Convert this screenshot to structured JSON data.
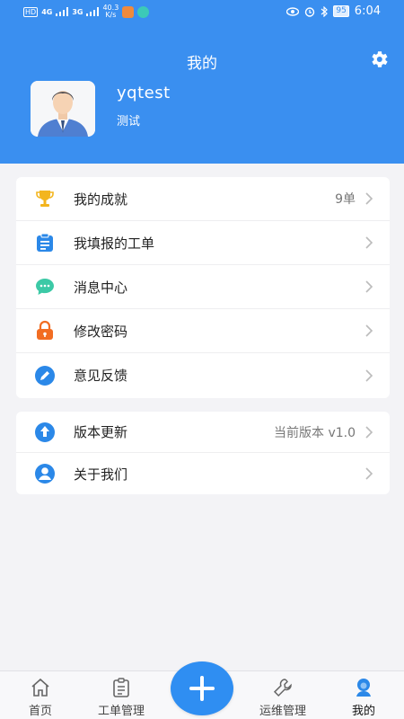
{
  "status": {
    "network": "4G",
    "network2": "3G",
    "speed_value": "40.3",
    "speed_unit": "K/s",
    "battery": "95",
    "time": "6:04"
  },
  "header": {
    "title": "我的",
    "user_name": "yqtest",
    "user_subtitle": "测试"
  },
  "menu_group1": [
    {
      "label": "我的成就",
      "value": "9单",
      "icon": "trophy-icon"
    },
    {
      "label": "我填报的工单",
      "value": "",
      "icon": "clipboard-icon"
    },
    {
      "label": "消息中心",
      "value": "",
      "icon": "chat-icon"
    },
    {
      "label": "修改密码",
      "value": "",
      "icon": "lock-icon"
    },
    {
      "label": "意见反馈",
      "value": "",
      "icon": "pencil-icon"
    }
  ],
  "menu_group2": [
    {
      "label": "版本更新",
      "value": "当前版本 v1.0",
      "icon": "upload-icon"
    },
    {
      "label": "关于我们",
      "value": "",
      "icon": "user-icon"
    }
  ],
  "tabbar": {
    "tabs": [
      {
        "label": "首页",
        "icon": "home-icon"
      },
      {
        "label": "工单管理",
        "icon": "clipboard-outline-icon"
      },
      {
        "label": "运维管理",
        "icon": "wrench-icon"
      },
      {
        "label": "我的",
        "icon": "profile-icon"
      }
    ],
    "fab_icon": "plus-icon"
  },
  "colors": {
    "primary": "#3a8ff0",
    "trophy": "#f3b51e",
    "chat": "#3cc9a6",
    "lock": "#f26d22",
    "blue_icon": "#2b88e8"
  }
}
